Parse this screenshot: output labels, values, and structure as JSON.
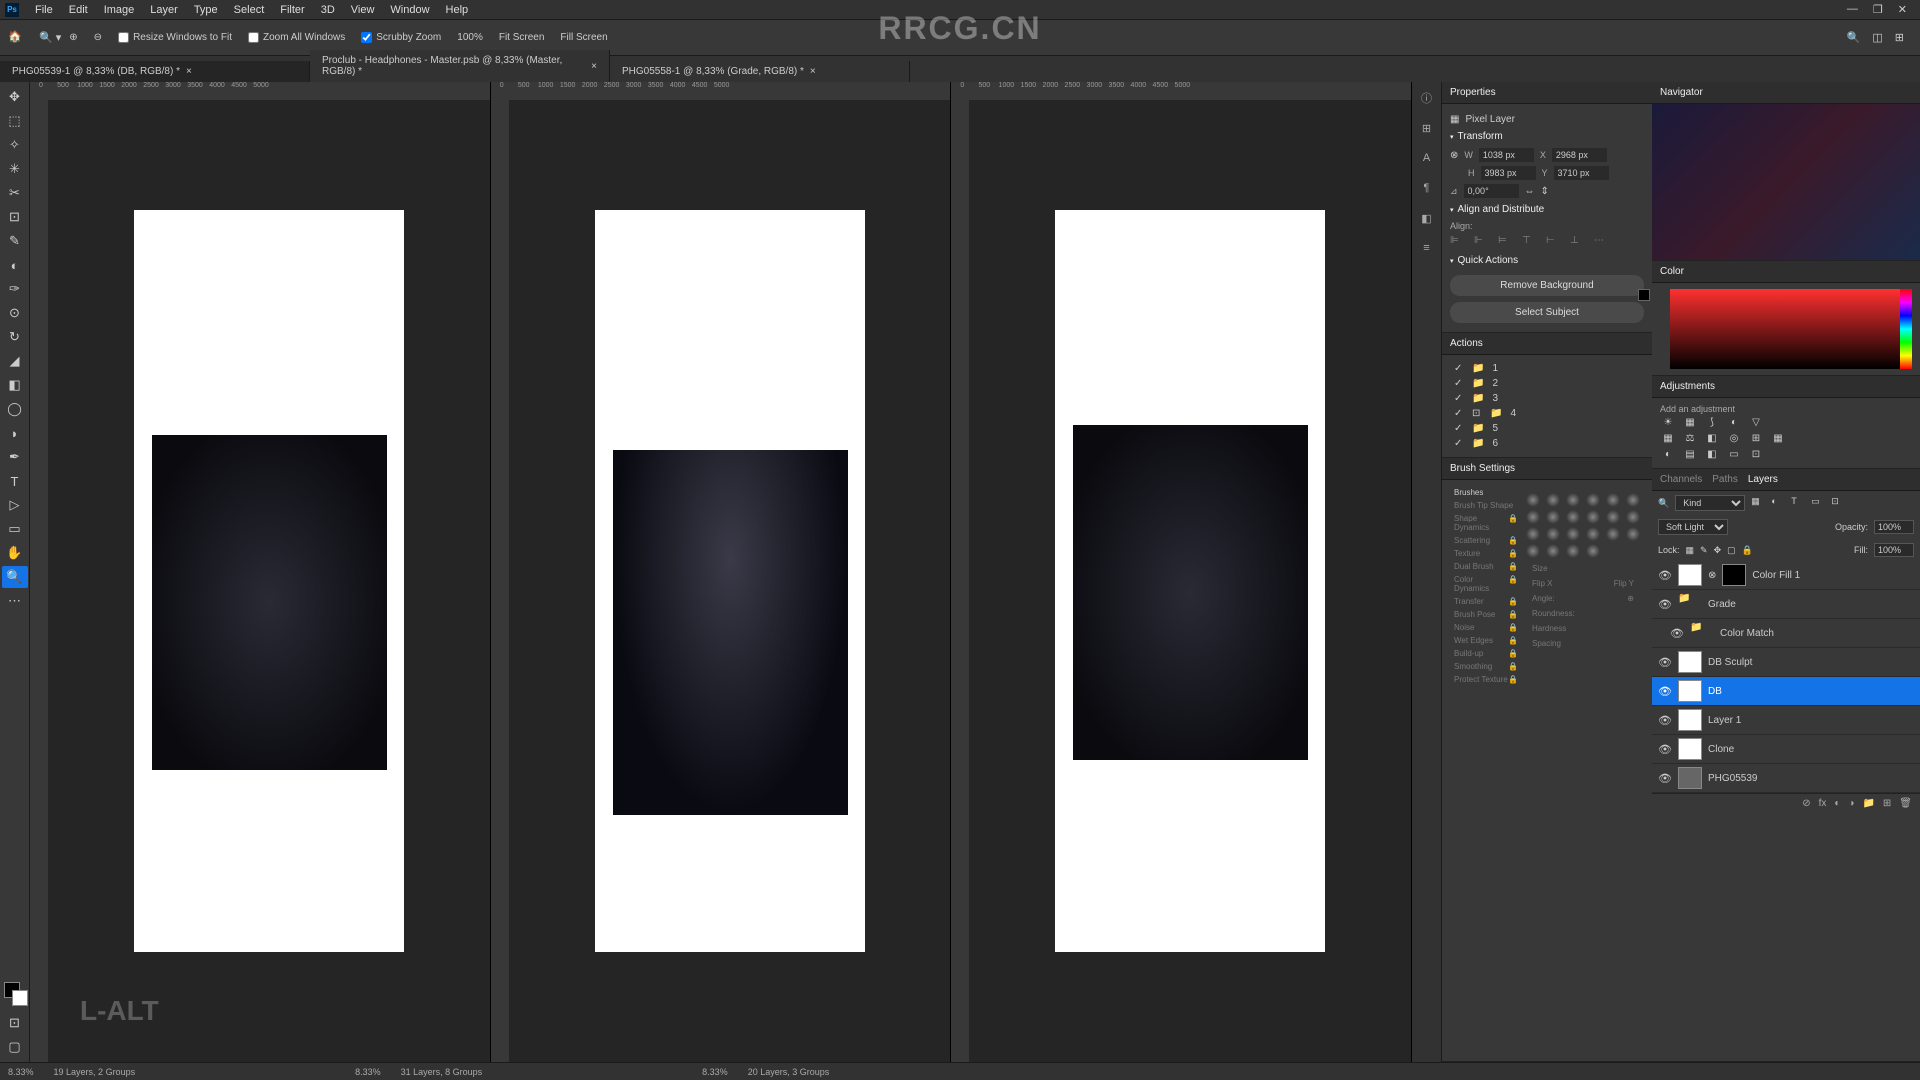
{
  "watermark": "RRCG.CN",
  "keypress": "L-ALT",
  "menu": {
    "items": [
      "File",
      "Edit",
      "Image",
      "Layer",
      "Type",
      "Select",
      "Filter",
      "3D",
      "View",
      "Window",
      "Help"
    ]
  },
  "options": {
    "resize_label": "Resize Windows to Fit",
    "zoom_all_label": "Zoom All Windows",
    "scrubby_label": "Scrubby Zoom",
    "zoom_value": "100%",
    "fit_screen": "Fit Screen",
    "fill_screen": "Fill Screen"
  },
  "tabs": [
    {
      "label": "PHG05539-1 @ 8,33% (DB, RGB/8) *"
    },
    {
      "label": "Proclub - Headphones - Master.psb @ 8,33% (Master, RGB/8) *"
    },
    {
      "label": "PHG05558-1 @ 8,33% (Grade, RGB/8) *"
    }
  ],
  "tools": [
    "↖",
    "⬚",
    "✧",
    "✂",
    "⊡",
    "✎",
    "✑",
    "⟋",
    "◢",
    "⊙",
    "◧",
    "⊘",
    "⇳",
    "T",
    "▷",
    "⬡",
    "✋",
    "🔍",
    "⋯"
  ],
  "panel_strip_icons": [
    "ⓘ",
    "⬚",
    "A",
    "◧",
    "⊞",
    "≡"
  ],
  "properties": {
    "title": "Properties",
    "pixel_layer": "Pixel Layer",
    "transform": "Transform",
    "w": "1038 px",
    "h": "3983 px",
    "x": "2968 px",
    "y": "3710 px",
    "angle": "0,00°",
    "align_title": "Align and Distribute",
    "align_label": "Align:",
    "quick_actions": "Quick Actions",
    "remove_bg": "Remove Background",
    "select_subject": "Select Subject"
  },
  "navigator": {
    "title": "Navigator"
  },
  "color": {
    "title": "Color"
  },
  "adjustments": {
    "title": "Adjustments",
    "add_label": "Add an adjustment"
  },
  "actions": {
    "title": "Actions",
    "items": [
      "1",
      "2",
      "3",
      "4",
      "5",
      "6"
    ]
  },
  "brush_settings": {
    "title": "Brush Settings",
    "brushes_tab": "Brushes",
    "options": [
      "Brush Tip Shape",
      "Shape Dynamics",
      "Scattering",
      "Texture",
      "Dual Brush",
      "Color Dynamics",
      "Transfer",
      "Brush Pose",
      "Noise",
      "Wet Edges",
      "Build-up",
      "Smoothing",
      "Protect Texture"
    ],
    "size_label": "Size",
    "flipx": "Flip X",
    "flipy": "Flip Y",
    "angle_label": "Angle:",
    "roundness_label": "Roundness:",
    "hardness_label": "Hardness",
    "spacing_label": "Spacing"
  },
  "layers": {
    "tabs": [
      "Channels",
      "Paths",
      "Layers"
    ],
    "kind": "Kind",
    "blend_mode": "Soft Light",
    "opacity_label": "Opacity:",
    "opacity_value": "100%",
    "lock_label": "Lock:",
    "fill_label": "Fill:",
    "fill_value": "100%",
    "items": [
      {
        "name": "Color Fill 1",
        "type": "fill"
      },
      {
        "name": "Grade",
        "type": "folder"
      },
      {
        "name": "Color Match",
        "type": "folder"
      },
      {
        "name": "DB Sculpt",
        "type": "adj"
      },
      {
        "name": "DB",
        "type": "adj",
        "active": true
      },
      {
        "name": "Layer 1",
        "type": "layer"
      },
      {
        "name": "Clone",
        "type": "layer"
      },
      {
        "name": "PHG05539",
        "type": "layer"
      }
    ]
  },
  "status": [
    {
      "zoom": "8.33%",
      "info": "19 Layers, 2 Groups"
    },
    {
      "zoom": "8.33%",
      "info": "31 Layers, 8 Groups"
    },
    {
      "zoom": "8.33%",
      "info": "20 Layers, 3 Groups"
    }
  ],
  "ruler_marks": [
    "0",
    "500",
    "1000",
    "1500",
    "2000",
    "2500",
    "3000",
    "3500",
    "4000",
    "4500",
    "5000"
  ]
}
